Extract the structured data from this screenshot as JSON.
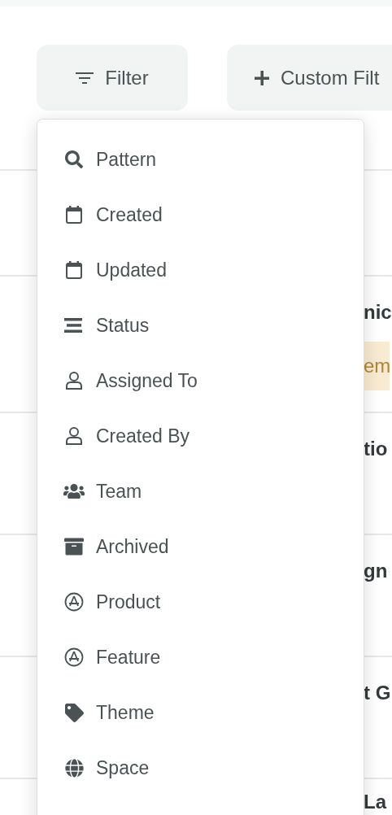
{
  "toolbar": {
    "filter_button": "Filter",
    "custom_filter_button": "Custom Filt"
  },
  "rows": [
    {
      "title": "nic",
      "badge": "em"
    },
    {
      "title": "tio"
    },
    {
      "title": "gn"
    },
    {
      "title": "t G"
    },
    {
      "title": "La"
    }
  ],
  "filter_menu": {
    "items": [
      {
        "label": "Pattern"
      },
      {
        "label": "Created"
      },
      {
        "label": "Updated"
      },
      {
        "label": "Status"
      },
      {
        "label": "Assigned To"
      },
      {
        "label": "Created By"
      },
      {
        "label": "Team"
      },
      {
        "label": "Archived"
      },
      {
        "label": "Product"
      },
      {
        "label": "Feature"
      },
      {
        "label": "Theme"
      },
      {
        "label": "Space"
      }
    ]
  }
}
